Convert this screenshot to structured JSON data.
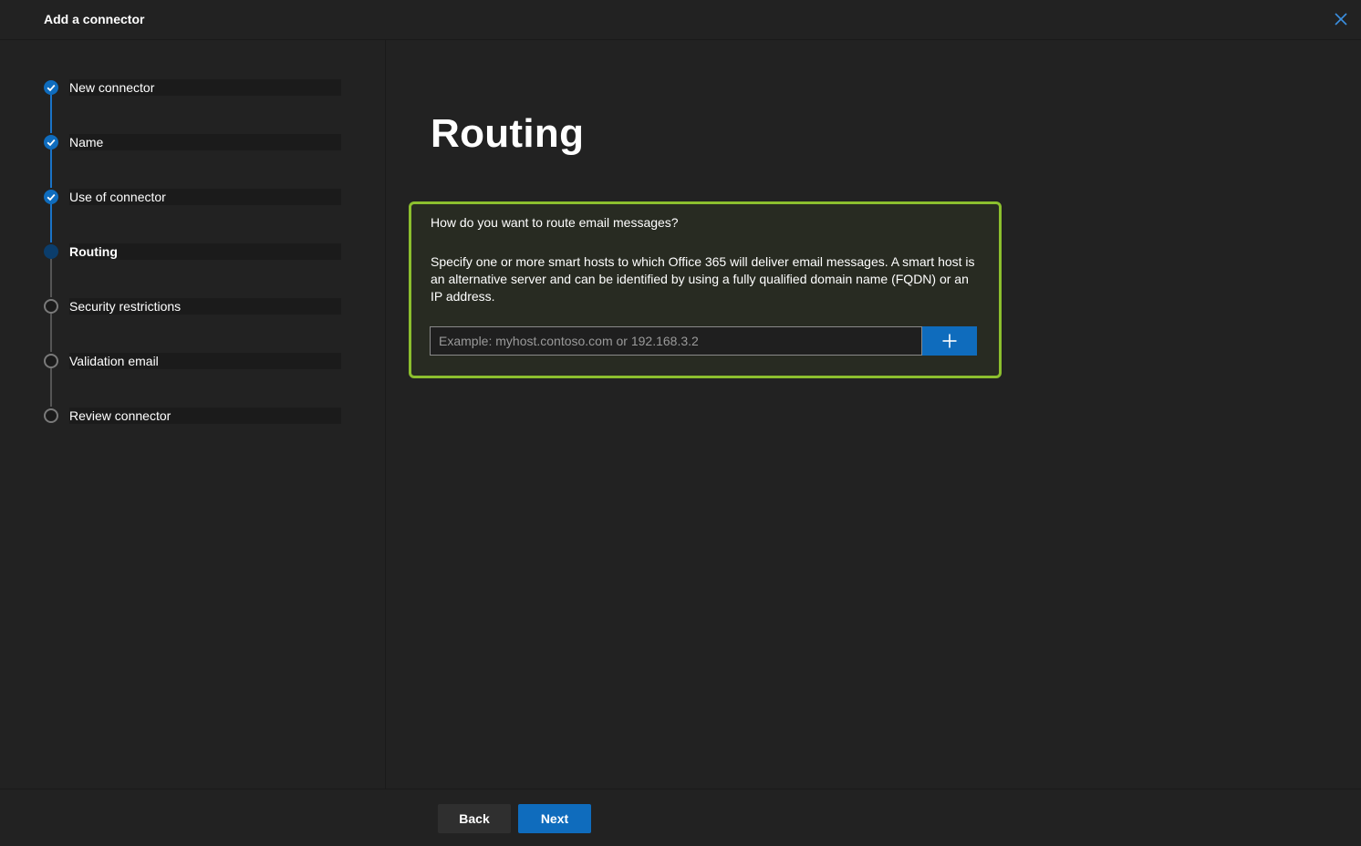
{
  "dialog": {
    "title": "Add a connector",
    "close_icon": "close-icon"
  },
  "steps": [
    {
      "label": "New connector",
      "status": "completed"
    },
    {
      "label": "Name",
      "status": "completed"
    },
    {
      "label": "Use of connector",
      "status": "completed"
    },
    {
      "label": "Routing",
      "status": "current"
    },
    {
      "label": "Security restrictions",
      "status": "pending"
    },
    {
      "label": "Validation email",
      "status": "pending"
    },
    {
      "label": "Review connector",
      "status": "pending"
    }
  ],
  "main": {
    "title": "Routing",
    "question": "How do you want to route email messages?",
    "description": "Specify one or more smart hosts to which Office 365 will deliver email messages. A smart host is an alternative server and can be identified by using a fully qualified domain name (FQDN) or an IP address.",
    "host_input": {
      "value": "",
      "placeholder": "Example: myhost.contoso.com or 192.168.3.2"
    },
    "add_icon": "plus-icon"
  },
  "footer": {
    "back_label": "Back",
    "next_label": "Next"
  },
  "colors": {
    "accent": "#0f6cbd",
    "highlight_border": "#8cbf2e",
    "background": "#222222"
  }
}
